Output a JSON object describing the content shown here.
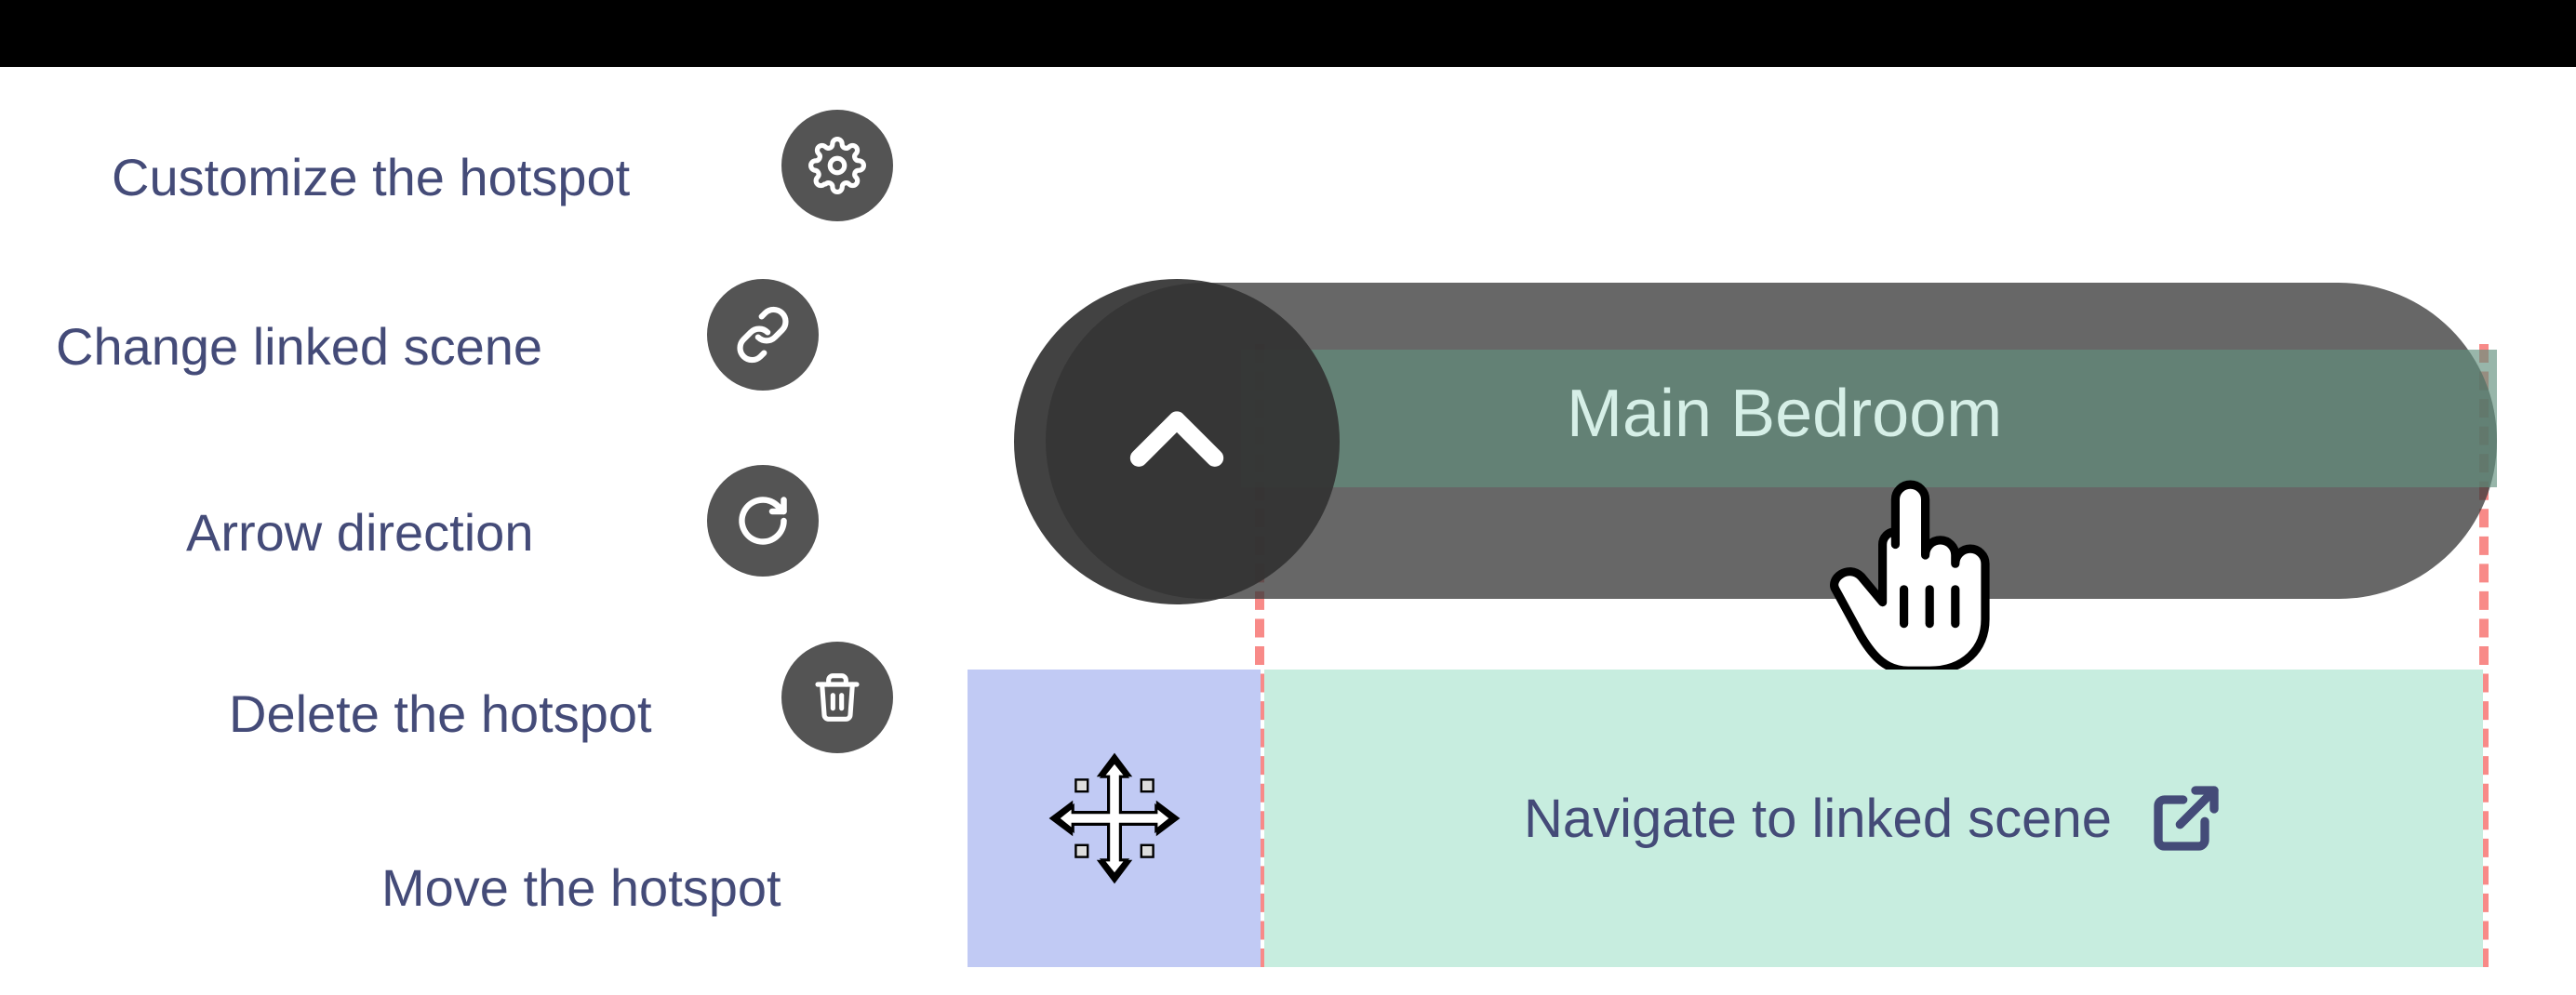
{
  "labels": {
    "customize": "Customize the hotspot",
    "change_link": "Change linked scene",
    "arrow_direction": "Arrow direction",
    "delete": "Delete the hotspot",
    "move": "Move the hotspot"
  },
  "scene_title": "Main Bedroom",
  "navigate_label": "Navigate to linked scene"
}
